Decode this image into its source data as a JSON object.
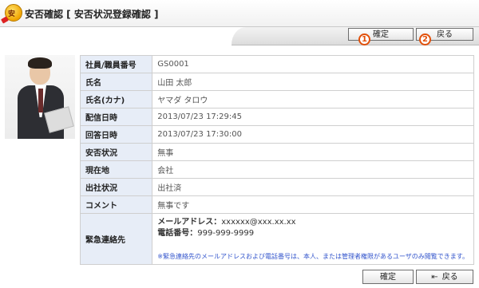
{
  "header": {
    "title": "安否確認 [ 安否状況登録確認 ]",
    "icon_text": "安"
  },
  "toolbar": {
    "confirm_label": "確定",
    "back_label": "戻る",
    "markers": [
      "1",
      "2"
    ]
  },
  "record": {
    "rows": [
      {
        "label": "社員/職員番号",
        "value": "GS0001"
      },
      {
        "label": "氏名",
        "value": "山田 太郎"
      },
      {
        "label": "氏名(カナ)",
        "value": "ヤマダ タロウ"
      },
      {
        "label": "配信日時",
        "value": "2013/07/23 17:29:45"
      },
      {
        "label": "回答日時",
        "value": "2013/07/23 17:30:00"
      },
      {
        "label": "安否状況",
        "value": "無事"
      },
      {
        "label": "現在地",
        "value": "会社"
      },
      {
        "label": "出社状況",
        "value": "出社済"
      },
      {
        "label": "コメント",
        "value": "無事です"
      }
    ],
    "contact": {
      "label": "緊急連絡先",
      "email_key": "メールアドレス：",
      "email_value": "xxxxxx@xxx.xx.xx",
      "phone_key": "電話番号：",
      "phone_value": "999-999-9999",
      "note": "※緊急連絡先のメールアドレスおよび電話番号は、本人、または管理者権限があるユーザのみ閲覧できます。"
    }
  },
  "footer": {
    "confirm_label": "確定",
    "back_label": "戻る",
    "back_icon": "back-arrow-icon"
  },
  "colors": {
    "label_bg": "#e7edf7",
    "marker": "#e2500a",
    "note": "#3355cc"
  }
}
